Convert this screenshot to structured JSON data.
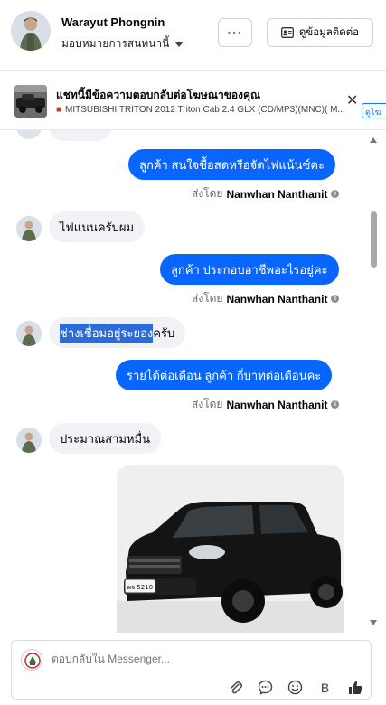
{
  "header": {
    "name": "Warayut Phongnin",
    "assign_label": "มอบหมายการสนทนานี้",
    "more_label": "···",
    "contact_label": "ดูข้อมูลติดต่อ"
  },
  "ad": {
    "title": "แชทนี้มีข้อความตอบกลับต่อโฆษณาของคุณ",
    "subtitle": "MITSUBISHI TRITON 2012 Triton Cab 2.4 GLX (CD/MP3)(MNC)( M...",
    "link_label": "ดูโฆ",
    "close_label": "✕"
  },
  "messages": [
    {
      "direction": "out",
      "text": "ลูกค้า สนใจซื้อสดหรือจัดไฟแน้นซ์คะ",
      "sent_by_prefix": "ส่งโดย",
      "sent_by_name": "Nanwhan Nanthanit"
    },
    {
      "direction": "in",
      "text": "ไฟแนนครับผม"
    },
    {
      "direction": "out",
      "text": "ลูกค้า ประกอบอาชีพอะไรอยู่คะ",
      "sent_by_prefix": "ส่งโดย",
      "sent_by_name": "Nanwhan Nanthanit"
    },
    {
      "direction": "in",
      "text_highlight": "ช่างเชื่อมอยู่ระยอง",
      "text_rest": "ครับ"
    },
    {
      "direction": "out",
      "text": "รายได้ต่อเดือน  ลูกค้า กี่บาทต่อเดือนคะ",
      "sent_by_prefix": "ส่งโดย",
      "sent_by_name": "Nanwhan Nanthanit"
    },
    {
      "direction": "in",
      "text": "ประมาณสามหมื่น"
    }
  ],
  "photo": {
    "plate_text": "ผจ 5210"
  },
  "composer": {
    "placeholder": "ตอบกลับใน Messenger...",
    "tools": [
      "paperclip-icon",
      "chat-bubble-icon",
      "emoji-icon",
      "baht-icon",
      "thumbs-up-icon"
    ]
  },
  "colors": {
    "accent": "#0866ff",
    "incoming": "#f0f2f5",
    "highlight": "#2d6bd6"
  }
}
